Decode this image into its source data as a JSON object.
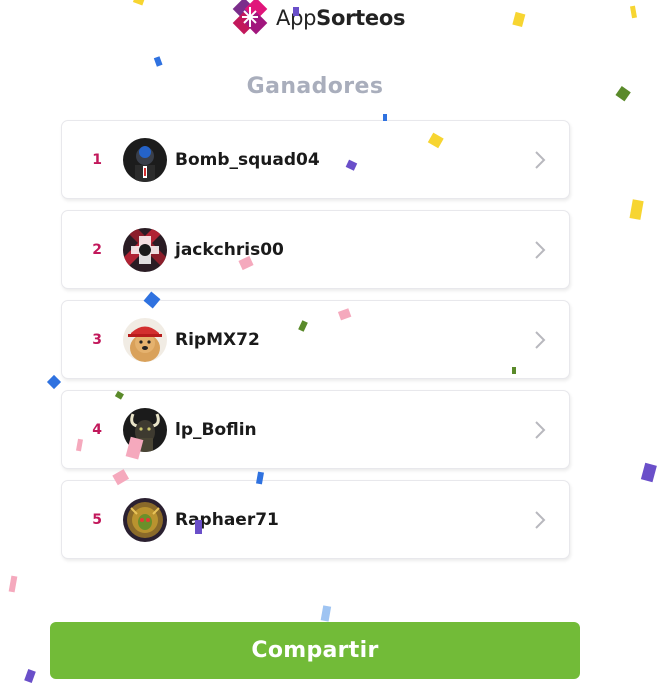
{
  "brand": {
    "name_regular": "App",
    "name_bold": "Sorteos"
  },
  "title": "Ganadores",
  "winners": [
    {
      "rank": "1",
      "username": "Bomb_squad04"
    },
    {
      "rank": "2",
      "username": "jackchris00"
    },
    {
      "rank": "3",
      "username": "RipMX72"
    },
    {
      "rank": "4",
      "username": "lp_Boflin"
    },
    {
      "rank": "5",
      "username": "Raphaer71"
    }
  ],
  "share_label": "Compartir",
  "colors": {
    "rank": "#c2185b",
    "share_button": "#72bb38",
    "title": "#a9aebc",
    "logo_magenta": "#c2185b",
    "logo_purple": "#7b2d8b"
  },
  "icons": {
    "chevron": "chevron-right-icon",
    "logo": "appsorteos-logo-icon"
  }
}
